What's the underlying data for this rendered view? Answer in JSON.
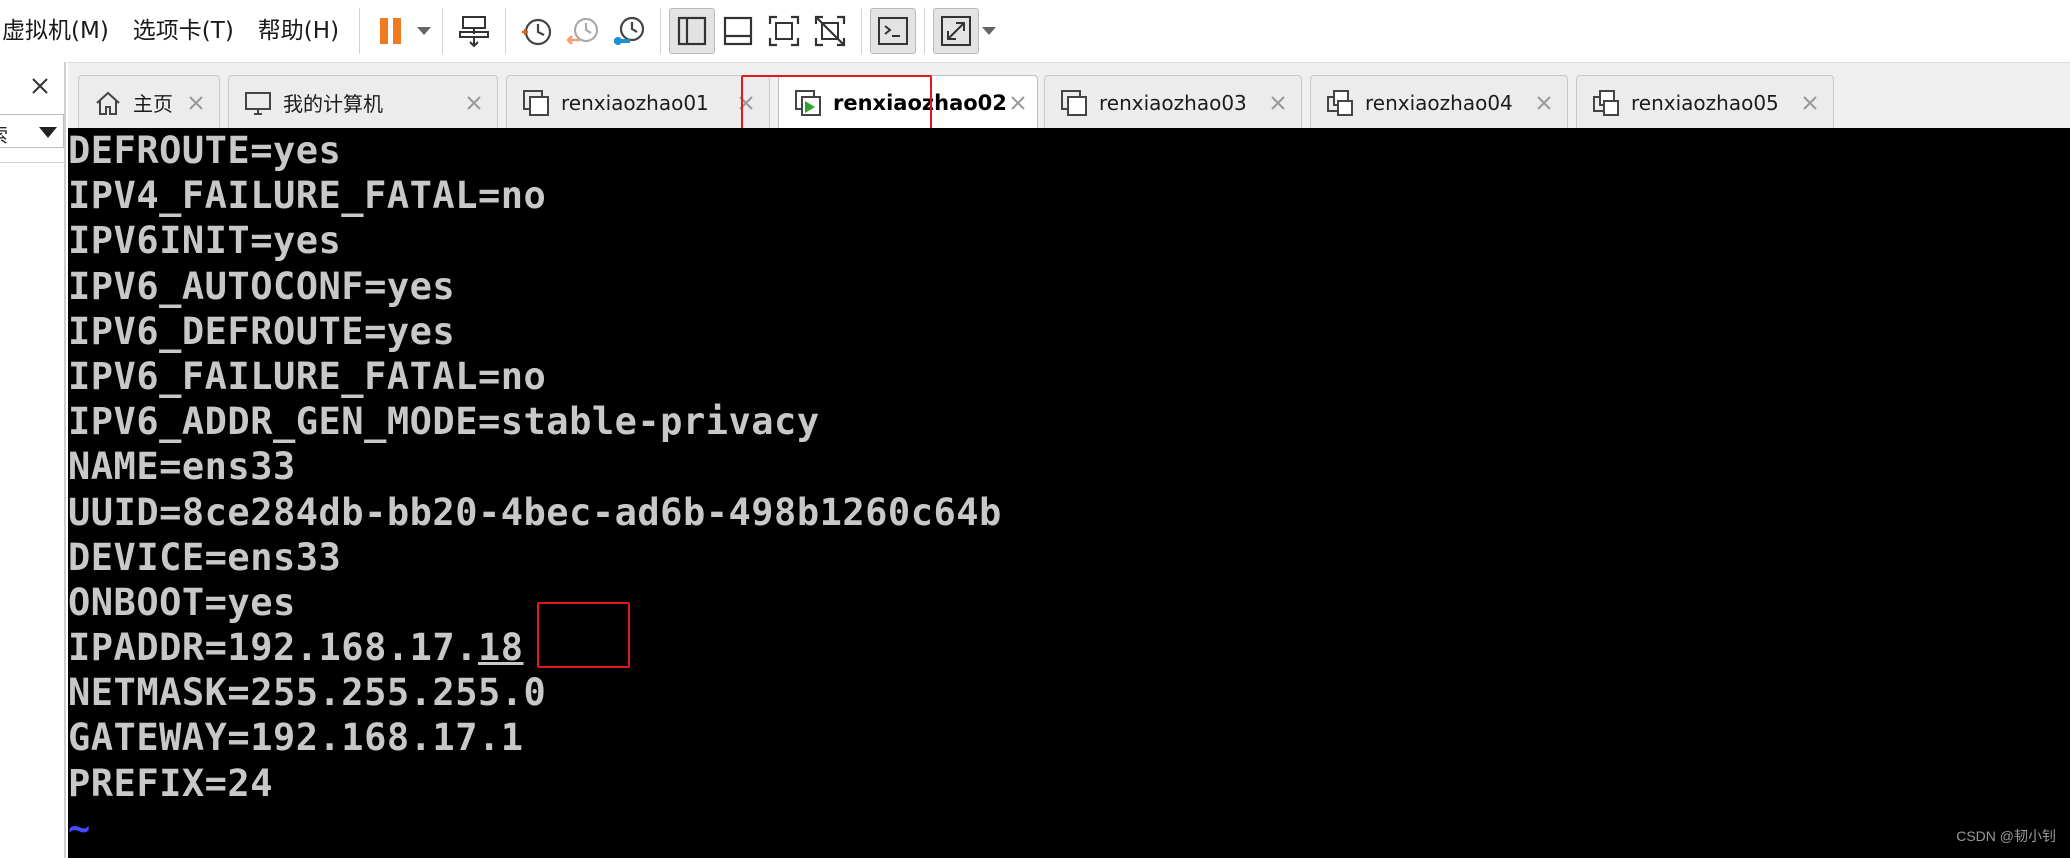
{
  "menu": {
    "vm": "虚拟机(M)",
    "tabs": "选项卡(T)",
    "help": "帮助(H)"
  },
  "colors": {
    "pause_orange": "#f07a1f",
    "highlight_red": "#e0191b",
    "terminal_bg": "#000000",
    "terminal_text": "#c8c8c8",
    "tilde_blue": "#4848ff"
  },
  "toolbar": {
    "icons": [
      "pause-icon",
      "send-ctrl-alt-del-icon",
      "snapshot-icon",
      "revert-snapshot-icon",
      "snapshot-manager-icon",
      "library-view-icon",
      "thumbnail-view-icon",
      "fullscreen-icon",
      "unity-icon",
      "console-view-icon",
      "stretch-icon"
    ]
  },
  "left_panel": {
    "search_text": "索"
  },
  "tabs": [
    {
      "label": "主页",
      "icon": "home-icon",
      "active": false
    },
    {
      "label": "我的计算机",
      "icon": "computer-icon",
      "active": false
    },
    {
      "label": "renxiaozhao01",
      "icon": "vm-icon",
      "active": false
    },
    {
      "label": "renxiaozhao02",
      "icon": "vm-running-icon",
      "active": true
    },
    {
      "label": "renxiaozhao03",
      "icon": "vm-icon",
      "active": false
    },
    {
      "label": "renxiaozhao04",
      "icon": "vm-linked-icon",
      "active": false
    },
    {
      "label": "renxiaozhao05",
      "icon": "vm-linked-icon",
      "active": false
    }
  ],
  "terminal": {
    "lines": [
      "DEFROUTE=yes",
      "IPV4_FAILURE_FATAL=no",
      "IPV6INIT=yes",
      "IPV6_AUTOCONF=yes",
      "IPV6_DEFROUTE=yes",
      "IPV6_FAILURE_FATAL=no",
      "IPV6_ADDR_GEN_MODE=stable-privacy",
      "NAME=ens33",
      "UUID=8ce284db-bb20-4bec-ad6b-498b1260c64b",
      "DEVICE=ens33",
      "ONBOOT=yes",
      "IPADDR=192.168.17.",
      "NETMASK=255.255.255.0",
      "GATEWAY=192.168.17.1",
      "PREFIX=24"
    ],
    "ipaddr_suffix": "18",
    "tilde": "~"
  },
  "watermark": "CSDN @韧小钊"
}
